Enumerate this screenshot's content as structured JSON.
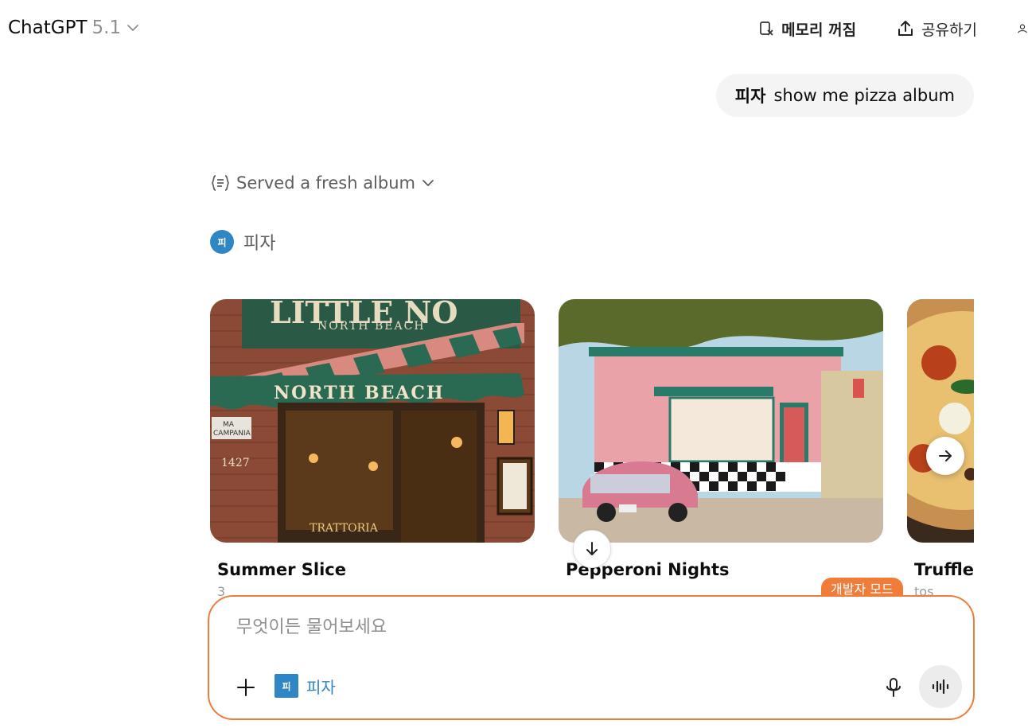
{
  "header": {
    "model_name": "ChatGPT",
    "model_version": "5.1",
    "memory_label": "메모리 꺼짐",
    "share_label": "공유하기"
  },
  "user_message": {
    "app_mention": "피자",
    "text": "show me pizza album"
  },
  "reasoning": {
    "label": "Served a fresh album"
  },
  "app": {
    "icon_letter": "피",
    "name": "피자",
    "color": "#2f86c5"
  },
  "carousel": {
    "cards": [
      {
        "title": "Summer Slice",
        "subtitle": "3"
      },
      {
        "title": "Pepperoni Nights",
        "subtitle": ""
      },
      {
        "title": "Truffle",
        "subtitle": "tos"
      }
    ]
  },
  "composer": {
    "placeholder": "무엇이든 물어보세요",
    "dev_mode_badge": "개발자 모드",
    "app_chip_letter": "피",
    "app_chip_label": "피자",
    "accent_color": "#f07c3a"
  },
  "icons": [
    "chevron-down-icon",
    "memory-off-icon",
    "share-icon",
    "user-icon",
    "reasoning-icon",
    "arrow-right-icon",
    "arrow-down-icon",
    "plus-icon",
    "mic-icon",
    "voice-icon"
  ]
}
